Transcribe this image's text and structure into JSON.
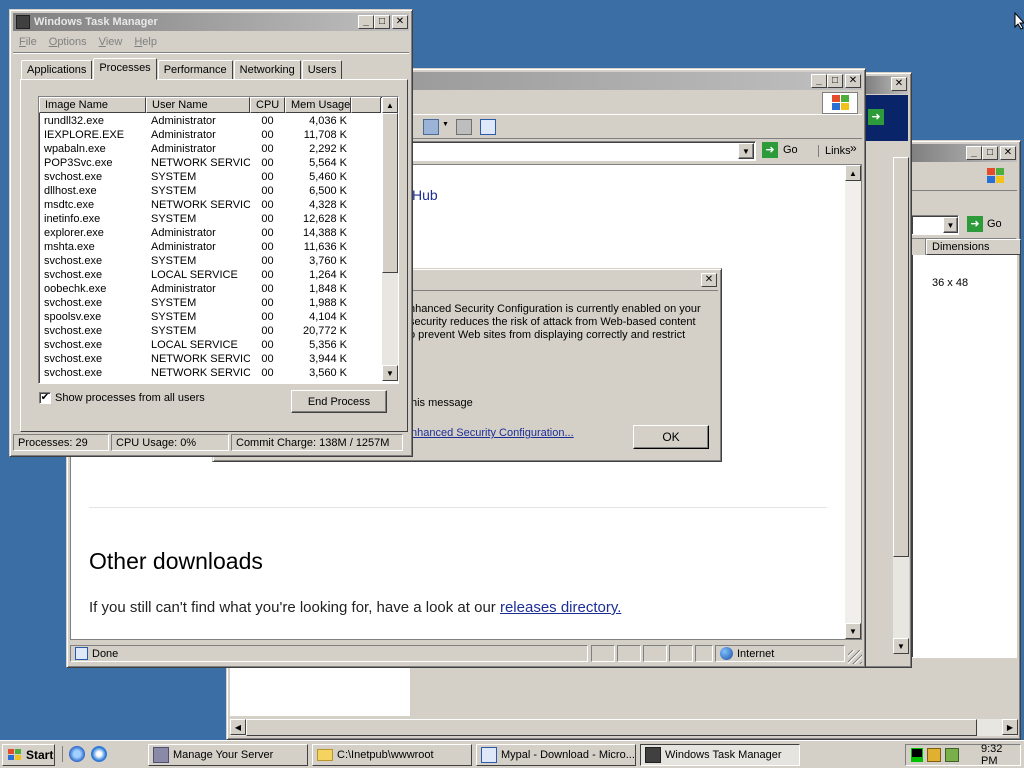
{
  "taskmgr": {
    "title": "Windows Task Manager",
    "menu": [
      "File",
      "Options",
      "View",
      "Help"
    ],
    "tabs": [
      "Applications",
      "Processes",
      "Performance",
      "Networking",
      "Users"
    ],
    "columns": [
      "Image Name",
      "User Name",
      "CPU",
      "Mem Usage"
    ],
    "rows": [
      [
        "rundll32.exe",
        "Administrator",
        "00",
        "4,036 K"
      ],
      [
        "IEXPLORE.EXE",
        "Administrator",
        "00",
        "11,708 K"
      ],
      [
        "wpabaln.exe",
        "Administrator",
        "00",
        "2,292 K"
      ],
      [
        "POP3Svc.exe",
        "NETWORK SERVICE",
        "00",
        "5,564 K"
      ],
      [
        "svchost.exe",
        "SYSTEM",
        "00",
        "5,460 K"
      ],
      [
        "dllhost.exe",
        "SYSTEM",
        "00",
        "6,500 K"
      ],
      [
        "msdtc.exe",
        "NETWORK SERVICE",
        "00",
        "4,328 K"
      ],
      [
        "inetinfo.exe",
        "SYSTEM",
        "00",
        "12,628 K"
      ],
      [
        "explorer.exe",
        "Administrator",
        "00",
        "14,388 K"
      ],
      [
        "mshta.exe",
        "Administrator",
        "00",
        "11,636 K"
      ],
      [
        "svchost.exe",
        "SYSTEM",
        "00",
        "3,760 K"
      ],
      [
        "svchost.exe",
        "LOCAL SERVICE",
        "00",
        "1,264 K"
      ],
      [
        "oobechk.exe",
        "Administrator",
        "00",
        "1,848 K"
      ],
      [
        "svchost.exe",
        "SYSTEM",
        "00",
        "1,988 K"
      ],
      [
        "spoolsv.exe",
        "SYSTEM",
        "00",
        "4,104 K"
      ],
      [
        "svchost.exe",
        "SYSTEM",
        "00",
        "20,772 K"
      ],
      [
        "svchost.exe",
        "LOCAL SERVICE",
        "00",
        "5,356 K"
      ],
      [
        "svchost.exe",
        "NETWORK SERVICE",
        "00",
        "3,944 K"
      ],
      [
        "svchost.exe",
        "NETWORK SERVICE",
        "00",
        "3,560 K"
      ]
    ],
    "show_all_label": "Show processes from all users",
    "show_all_checked": true,
    "end_process_label": "End Process",
    "status": {
      "processes": "Processes: 29",
      "cpu": "CPU Usage: 0%",
      "commit": "Commit Charge: 138M / 1257M"
    }
  },
  "browser": {
    "go_label": "Go",
    "links_label": "Links",
    "hub_text": "Hub",
    "heading": "Other downloads",
    "body_text": "If you still can't find what you're looking for, have a look at our ",
    "body_link": "releases directory.",
    "status_done": "Done",
    "status_zone": "Internet"
  },
  "dialog": {
    "line1": "nhanced Security Configuration is currently enabled on your",
    "line2": " security reduces the risk of attack from Web-based content",
    "line3": "o prevent Web sites from displaying correctly and restrict",
    "message_text": "his message",
    "link_text": "nhanced Security Configuration...",
    "ok_label": "OK"
  },
  "explorer": {
    "go_label": "Go",
    "column": "Dimensions",
    "value": "36 x 48"
  },
  "taskbar": {
    "start_label": "Start",
    "items": [
      {
        "label": "Manage Your Server"
      },
      {
        "label": "C:\\Inetpub\\wwwroot"
      },
      {
        "label": "Mypal - Download - Micro..."
      },
      {
        "label": "Windows Task Manager"
      }
    ],
    "clock": "9:32 PM"
  },
  "colors": {
    "desktop": "#3a6ea5",
    "active_title": "#0a246a",
    "face": "#d4d0c8",
    "link": "#1c2e96"
  }
}
